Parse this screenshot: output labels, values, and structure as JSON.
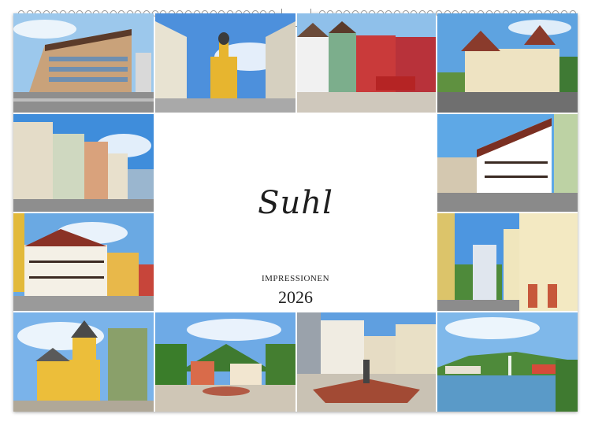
{
  "calendar": {
    "title": "Suhl",
    "subtitle": "IMPRESSIONEN",
    "year": "2026"
  },
  "photos": [
    {
      "name": "photo-modern-building",
      "subject": "street corner with modern office building"
    },
    {
      "name": "photo-yellow-church",
      "subject": "yellow baroque church tower at end of street"
    },
    {
      "name": "photo-market-square",
      "subject": "colorful facades and red bus on market square"
    },
    {
      "name": "photo-villa",
      "subject": "ornate historic villa with towers"
    },
    {
      "name": "photo-street-facades",
      "subject": "street lined with historic facades"
    },
    {
      "name": "photo-half-timbered-row",
      "subject": "row of half-timbered houses"
    },
    {
      "name": "photo-half-timbered-corner",
      "subject": "half-timbered houses on a corner"
    },
    {
      "name": "photo-tower-block",
      "subject": "high-rise tower behind yellow arcade building"
    },
    {
      "name": "photo-church-park",
      "subject": "yellow church with tree"
    },
    {
      "name": "photo-fountain-square",
      "subject": "square with fountain and hills"
    },
    {
      "name": "photo-plaza-fountain",
      "subject": "plaza with red-brick fountain basin"
    },
    {
      "name": "photo-lake",
      "subject": "lake with fountain and wooded hills"
    }
  ],
  "colors": {
    "sky": "#5f9fe0",
    "grass": "#4f8f3a",
    "ring": "#9a9a9a"
  }
}
